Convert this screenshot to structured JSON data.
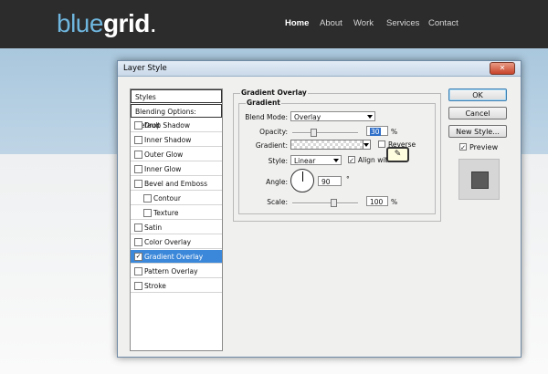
{
  "site": {
    "logo_part1": "blue",
    "logo_part2": "grid",
    "logo_dot": ".",
    "nav": [
      "Home",
      "About",
      "Work",
      "Services",
      "Contact"
    ]
  },
  "dialog": {
    "title": "Layer Style",
    "close_icon": "x-icon",
    "styles_list": [
      {
        "label": "Styles",
        "checkbox": false
      },
      {
        "label": "Blending Options: Default",
        "checkbox": false
      },
      {
        "label": "Drop Shadow",
        "checkbox": true,
        "checked": false
      },
      {
        "label": "Inner Shadow",
        "checkbox": true,
        "checked": false
      },
      {
        "label": "Outer Glow",
        "checkbox": true,
        "checked": false
      },
      {
        "label": "Inner Glow",
        "checkbox": true,
        "checked": false
      },
      {
        "label": "Bevel and Emboss",
        "checkbox": true,
        "checked": false
      },
      {
        "label": "Contour",
        "checkbox": true,
        "checked": false
      },
      {
        "label": "Texture",
        "checkbox": true,
        "checked": false
      },
      {
        "label": "Satin",
        "checkbox": true,
        "checked": false
      },
      {
        "label": "Color Overlay",
        "checkbox": true,
        "checked": false
      },
      {
        "label": "Gradient Overlay",
        "checkbox": true,
        "checked": true,
        "selected": true
      },
      {
        "label": "Pattern Overlay",
        "checkbox": true,
        "checked": false
      },
      {
        "label": "Stroke",
        "checkbox": true,
        "checked": false
      }
    ],
    "section_title": "Gradient Overlay",
    "subsection_title": "Gradient",
    "blend_mode": {
      "label": "Blend Mode:",
      "value": "Overlay"
    },
    "opacity": {
      "label": "Opacity:",
      "value": "30",
      "unit": "%",
      "level": 0.3
    },
    "gradient": {
      "label": "Gradient:",
      "reverse_label": "Reverse",
      "reverse_checked": false
    },
    "style": {
      "label": "Style:",
      "value": "Linear",
      "align_label": "Align with",
      "align_checked": true
    },
    "angle": {
      "label": "Angle:",
      "value": "90",
      "unit": "°"
    },
    "scale": {
      "label": "Scale:",
      "value": "100",
      "unit": "%",
      "level": 1.0
    },
    "tooltip_icon": "pencil-icon",
    "buttons": {
      "ok": "OK",
      "reset": "Cancel",
      "new_style": "New Style...",
      "preview": "Preview"
    },
    "preview_checked": true
  },
  "colors": {
    "accent": "#3b87d9",
    "header": "#2c2c2c",
    "logo_blue": "#6fb6de"
  }
}
